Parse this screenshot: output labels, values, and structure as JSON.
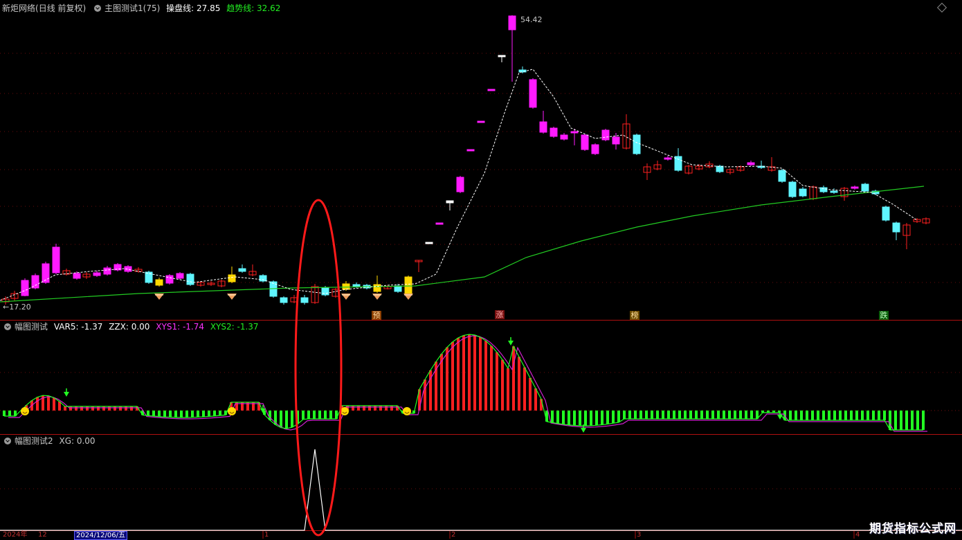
{
  "panel_main": {
    "stock_name": "新炬网络",
    "period": "(日线 前复权)",
    "indicator": "主图测试1(75)",
    "line1_label": "操盘线: 27.85",
    "line2_label": "趋势线: 32.62",
    "high_label": "54.42",
    "low_label": "17.20",
    "tags": [
      "预",
      "涨",
      "榜",
      "跌"
    ]
  },
  "panel_sub1": {
    "indicator": "幅图测试",
    "var5": "VAR5: -1.37",
    "zzx": "ZZX: 0.00",
    "xys1": "XYS1: -1.74",
    "xys2": "XYS2: -1.37"
  },
  "panel_sub2": {
    "indicator": "幅图测试2",
    "xg": "XG: 0.00"
  },
  "axis": {
    "year_label": "2024年",
    "month12": "12",
    "cursor_date": "2024/12/06/五",
    "m1": "1",
    "m2": "2",
    "m3": "3",
    "m4": "4"
  },
  "watermark": "期货指标公式网",
  "colors": {
    "up_magenta": "#ff1aff",
    "down_cyan": "#5ff5ff",
    "red": "#ff2020",
    "yellow": "#ffd800",
    "green_line": "#22cc22",
    "white": "#ffffff"
  }
}
